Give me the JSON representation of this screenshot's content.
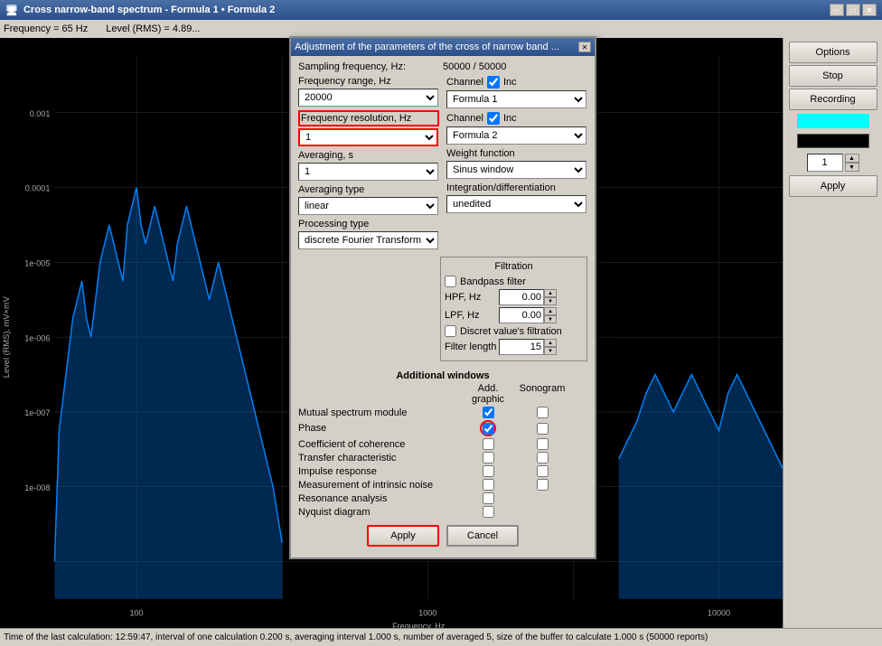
{
  "window": {
    "title": "Cross narrow-band spectrum - Formula 1 • Formula 2",
    "title_short": "Adjustment of the parameters of the cross of narrow band ..."
  },
  "topbar": {
    "frequency_label": "Frequency = 65 Hz",
    "level_label": "Level (RMS) = 4.89..."
  },
  "right_panel": {
    "options_label": "Options",
    "stop_label": "Stop",
    "recording_label": "Recording",
    "spinner_value": "1",
    "apply_label": "Apply"
  },
  "dialog": {
    "sampling_freq_label": "Sampling frequency, Hz:",
    "sampling_freq_value": "50000 / 50000",
    "freq_range_label": "Frequency range, Hz",
    "freq_range_value": "20000",
    "freq_resolution_label": "Frequency resolution, Hz",
    "freq_resolution_value": "1",
    "averaging_s_label": "Averaging, s",
    "averaging_s_value": "1",
    "averaging_type_label": "Averaging type",
    "averaging_type_value": "linear",
    "processing_type_label": "Processing type",
    "processing_type_value": "discrete Fourier Transform",
    "channel1_label": "Channel",
    "channel1_inc": "Inc",
    "channel1_value": "Formula 1",
    "channel2_label": "Channel",
    "channel2_inc": "Inc",
    "channel2_value": "Formula 2",
    "weight_function_label": "Weight function",
    "weight_function_value": "Sinus window",
    "integration_label": "Integration/differentiation",
    "integration_value": "unedited",
    "filtration_label": "Filtration",
    "bandpass_filter_label": "Bandpass filter",
    "hpf_label": "HPF, Hz",
    "hpf_value": "0.00",
    "lpf_label": "LPF, Hz",
    "lpf_value": "0.00",
    "discret_filter_label": "Discret value's filtration",
    "filter_length_label": "Filter length",
    "filter_length_value": "15",
    "additional_windows_label": "Additional windows",
    "add_graphic_label": "Add. graphic",
    "sonogram_label": "Sonogram",
    "rows": [
      {
        "label": "Mutual spectrum module",
        "add_graphic": true,
        "sonogram": false
      },
      {
        "label": "Phase",
        "add_graphic": true,
        "sonogram": false,
        "highlight": true
      },
      {
        "label": "Coefficient of coherence",
        "add_graphic": false,
        "sonogram": false
      },
      {
        "label": "Transfer characteristic",
        "add_graphic": false,
        "sonogram": false
      },
      {
        "label": "Impulse response",
        "add_graphic": false,
        "sonogram": false
      },
      {
        "label": "Measurement of intrinsic noise",
        "add_graphic": false,
        "sonogram": false
      },
      {
        "label": "Resonance analysis",
        "add_graphic": false,
        "sonogram": false
      },
      {
        "label": "Nyquist diagram",
        "add_graphic": false,
        "sonogram": false
      }
    ],
    "apply_label": "Apply",
    "cancel_label": "Cancel"
  },
  "status_bar": {
    "text": "Time of the last calculation: 12:59:47, interval of one calculation 0.200 s, averaging interval 1.000 s, number of averaged 5, size of the buffer to calculate 1.000 s (50000 reports)"
  },
  "chart": {
    "y_axis_label": "Level (RMS), mV×mV",
    "x_ticks": [
      "100",
      "1000",
      "10000"
    ],
    "y_ticks": [
      "0.001",
      "0.0001",
      "1e-005",
      "1e-006",
      "1e-007",
      "1e-008"
    ]
  }
}
